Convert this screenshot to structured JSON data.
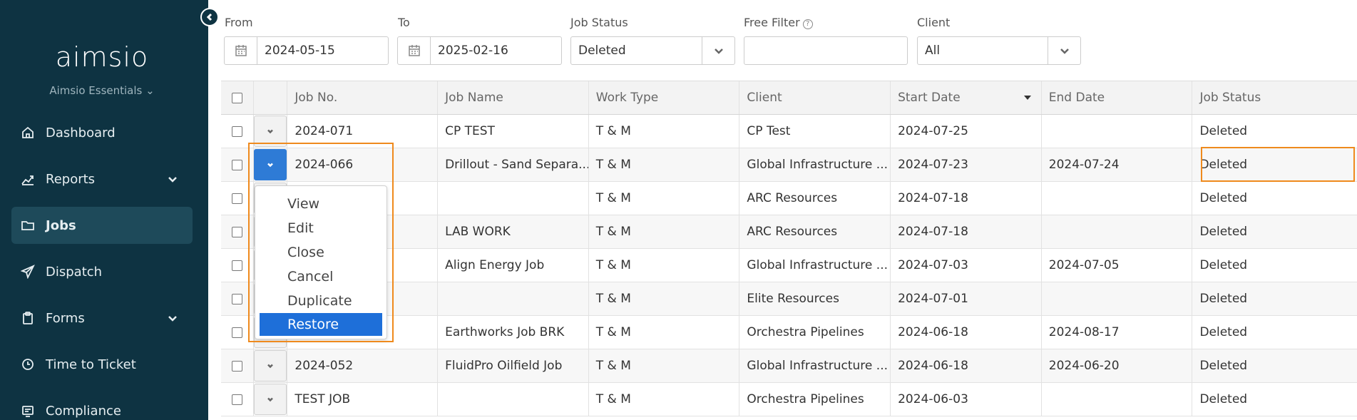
{
  "sidebar": {
    "logo": "aimsio",
    "subtitle": "Aimsio Essentials ⌄",
    "items": [
      {
        "label": "Dashboard",
        "icon": "home-icon",
        "active": false,
        "expandable": false
      },
      {
        "label": "Reports",
        "icon": "chart-icon",
        "active": false,
        "expandable": true
      },
      {
        "label": "Jobs",
        "icon": "folder-icon",
        "active": true,
        "expandable": false
      },
      {
        "label": "Dispatch",
        "icon": "send-icon",
        "active": false,
        "expandable": false
      },
      {
        "label": "Forms",
        "icon": "clipboard-icon",
        "active": false,
        "expandable": true
      },
      {
        "label": "Time to Ticket",
        "icon": "clock-icon",
        "active": false,
        "expandable": false
      },
      {
        "label": "Compliance",
        "icon": "compliance-icon",
        "active": false,
        "expandable": false
      }
    ]
  },
  "filters": {
    "from_label": "From",
    "from_value": "2024-05-15",
    "to_label": "To",
    "to_value": "2025-02-16",
    "status_label": "Job Status",
    "status_value": "Deleted",
    "free_label": "Free Filter",
    "free_value": "",
    "client_label": "Client",
    "client_value": "All"
  },
  "table": {
    "columns": [
      "Job No.",
      "Job Name",
      "Work Type",
      "Client",
      "Start Date",
      "End Date",
      "Job Status"
    ],
    "rows": [
      {
        "no": "2024-071",
        "name": "CP TEST",
        "type": "T & M",
        "client": "CP Test",
        "start": "2024-07-25",
        "end": "",
        "status": "Deleted"
      },
      {
        "no": "2024-066",
        "name": "Drillout - Sand Separa...",
        "type": "T & M",
        "client": "Global Infrastructure ...",
        "start": "2024-07-23",
        "end": "2024-07-24",
        "status": "Deleted"
      },
      {
        "no": "",
        "name": "",
        "type": "T & M",
        "client": "ARC Resources",
        "start": "2024-07-18",
        "end": "",
        "status": "Deleted"
      },
      {
        "no": "",
        "name": "LAB WORK",
        "type": "T & M",
        "client": "ARC Resources",
        "start": "2024-07-18",
        "end": "",
        "status": "Deleted"
      },
      {
        "no": "",
        "name": "Align Energy Job",
        "type": "T & M",
        "client": "Global Infrastructure ...",
        "start": "2024-07-03",
        "end": "2024-07-05",
        "status": "Deleted"
      },
      {
        "no": "",
        "name": "",
        "type": "T & M",
        "client": "Elite Resources",
        "start": "2024-07-01",
        "end": "",
        "status": "Deleted"
      },
      {
        "no": "",
        "name": "Earthworks Job BRK",
        "type": "T & M",
        "client": "Orchestra Pipelines",
        "start": "2024-06-18",
        "end": "2024-08-17",
        "status": "Deleted"
      },
      {
        "no": "2024-052",
        "name": "FluidPro Oilfield Job",
        "type": "T & M",
        "client": "Global Infrastructure ...",
        "start": "2024-06-18",
        "end": "2024-06-20",
        "status": "Deleted"
      },
      {
        "no": "TEST JOB",
        "name": "",
        "type": "T & M",
        "client": "Orchestra Pipelines",
        "start": "2024-06-03",
        "end": "",
        "status": "Deleted"
      }
    ]
  },
  "menu": {
    "items": [
      "View",
      "Edit",
      "Close",
      "Cancel",
      "Duplicate",
      "Restore"
    ],
    "selected": "Restore"
  },
  "colors": {
    "sidebar_bg": "#0e3342",
    "accent_blue": "#1e6fd9",
    "highlight_orange": "#ef8a1d"
  }
}
